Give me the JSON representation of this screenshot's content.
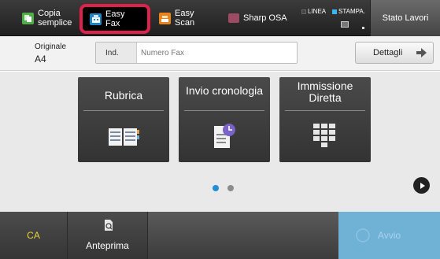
{
  "header": {
    "tabs": [
      {
        "label_line1": "Copia",
        "label_line2": "semplice",
        "icon": "copy-icon"
      },
      {
        "label_line1": "Easy",
        "label_line2": "Fax",
        "icon": "fax-icon"
      },
      {
        "label_line1": "Easy",
        "label_line2": "Scan",
        "icon": "scan-icon"
      },
      {
        "label": "Sharp OSA",
        "icon": "osa-icon"
      }
    ],
    "status_line": "LINEA",
    "status_print": "STAMPA.",
    "job_status_label": "Stato Lavori"
  },
  "info": {
    "original_label": "Originale",
    "original_value": "A4",
    "address_prefix": "Ind.",
    "address_placeholder": "Numero Fax",
    "details_label": "Dettagli"
  },
  "tiles": [
    {
      "label": "Rubrica",
      "icon": "address-book-icon"
    },
    {
      "label": "Invio cronologia",
      "icon": "send-history-icon"
    },
    {
      "label_line1": "Immissione",
      "label_line2": "Diretta",
      "icon": "keypad-icon"
    }
  ],
  "pagination": {
    "current": 1,
    "total": 2
  },
  "footer": {
    "clear_all_label": "CA",
    "preview_label": "Anteprima",
    "start_label": "Avvio"
  },
  "colors": {
    "highlight_border": "#e0214a",
    "page_dot_active": "#1e8fd8",
    "start_button": "#6fb2d6",
    "clear_all_text": "#e8d330"
  }
}
